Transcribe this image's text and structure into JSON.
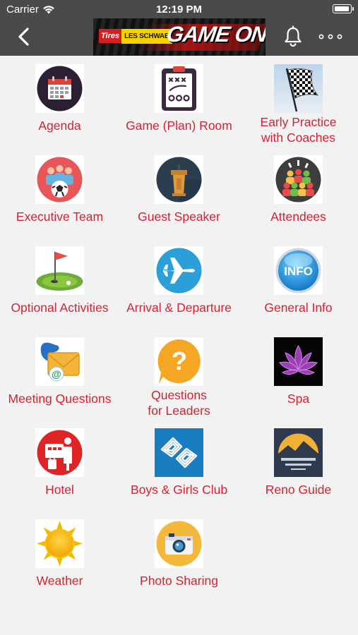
{
  "status_bar": {
    "carrier": "Carrier",
    "time": "12:19 PM"
  },
  "header": {
    "banner": {
      "tires": "Tires",
      "les_schwab": "LES SCHWAB",
      "title": "GAME ON"
    },
    "back_icon": "chevron-left-icon",
    "bell_icon": "bell-icon",
    "more_icon": "more-dots-icon"
  },
  "accent_color": "#d32233",
  "tiles": [
    {
      "label": "Agenda",
      "icon": "calendar-icon"
    },
    {
      "label": "Game (Plan) Room",
      "icon": "playbook-icon"
    },
    {
      "label": "Early Practice\nwith Coaches",
      "icon": "checkered-flag-icon"
    },
    {
      "label": "Executive Team",
      "icon": "team-soccer-icon"
    },
    {
      "label": "Guest Speaker",
      "icon": "podium-icon"
    },
    {
      "label": "Attendees",
      "icon": "people-group-icon"
    },
    {
      "label": "Optional Activities",
      "icon": "golf-icon"
    },
    {
      "label": "Arrival & Departure",
      "icon": "airplane-icon"
    },
    {
      "label": "General Info",
      "icon": "info-icon"
    },
    {
      "label": "Meeting Questions",
      "icon": "phone-email-icon"
    },
    {
      "label": "Questions\nfor Leaders",
      "icon": "question-icon"
    },
    {
      "label": "Spa",
      "icon": "lotus-icon"
    },
    {
      "label": "Hotel",
      "icon": "hotel-icon"
    },
    {
      "label": "Boys & Girls Club",
      "icon": "boys-girls-club-icon"
    },
    {
      "label": "Reno Guide",
      "icon": "mountain-icon"
    },
    {
      "label": "Weather",
      "icon": "sun-icon"
    },
    {
      "label": "Photo Sharing",
      "icon": "camera-icon"
    }
  ]
}
